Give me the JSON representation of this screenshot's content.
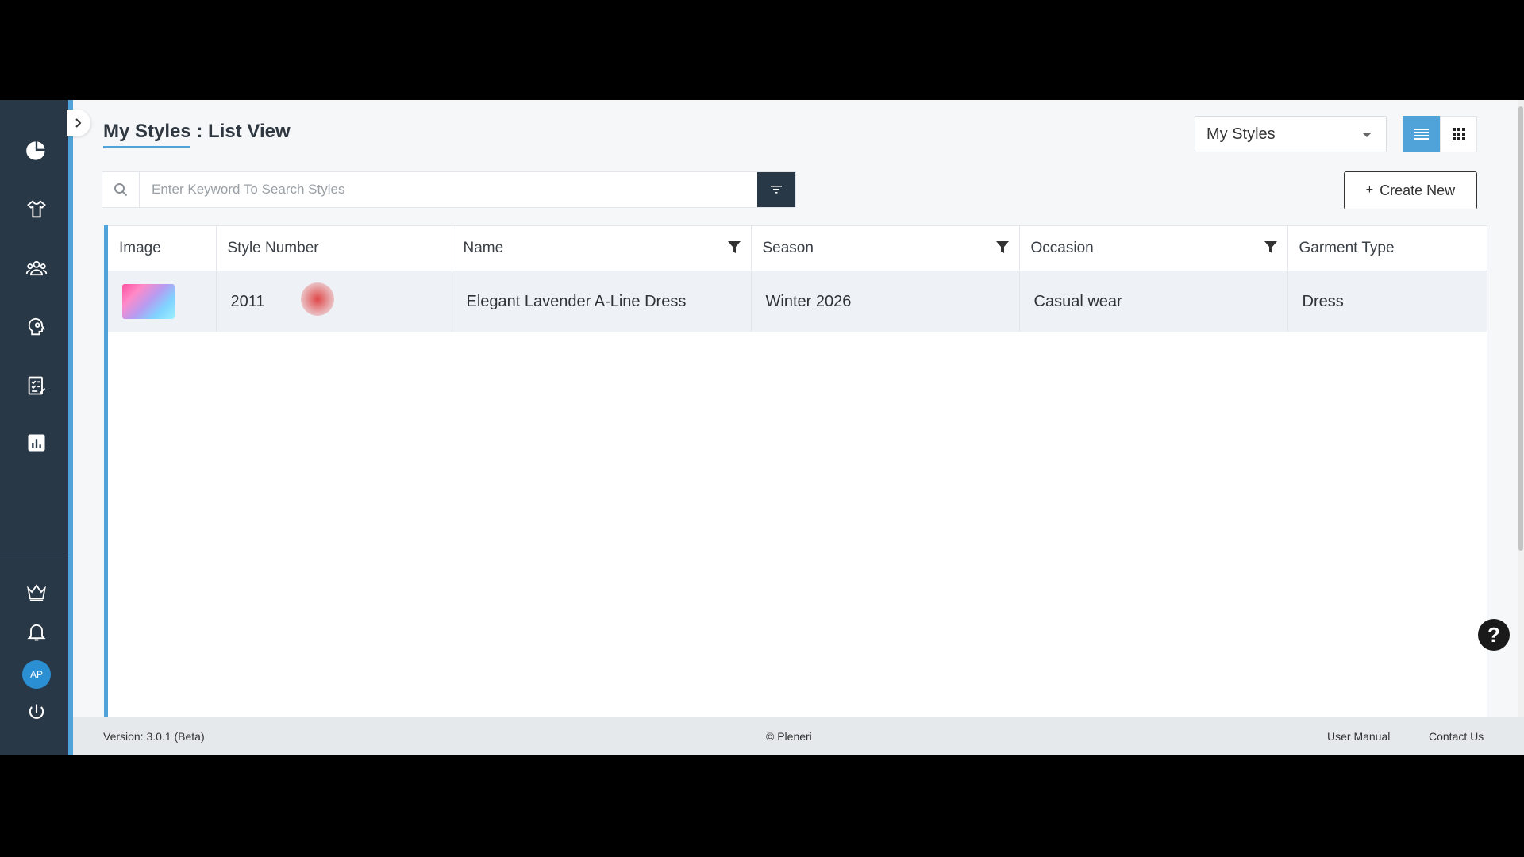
{
  "header": {
    "title": "My Styles : List View",
    "view_select": "My Styles"
  },
  "search": {
    "placeholder": "Enter Keyword To Search Styles"
  },
  "actions": {
    "create_new": "Create New"
  },
  "table": {
    "columns": [
      "Image",
      "Style Number",
      "Name",
      "Season",
      "Occasion",
      "Garment Type"
    ],
    "rows": [
      {
        "style_number": "2011",
        "name": "Elegant Lavender A-Line Dress",
        "season": "Winter 2026",
        "occasion": "Casual wear",
        "garment_type": "Dress"
      }
    ]
  },
  "sidebar": {
    "avatar_initials": "AP"
  },
  "footer": {
    "version": "Version: 3.0.1 (Beta)",
    "copyright": "© Pleneri",
    "user_manual": "User Manual",
    "contact_us": "Contact Us"
  },
  "help": {
    "label": "?"
  },
  "colors": {
    "sidebar_bg": "#293847",
    "accent": "#4fa3d8"
  }
}
